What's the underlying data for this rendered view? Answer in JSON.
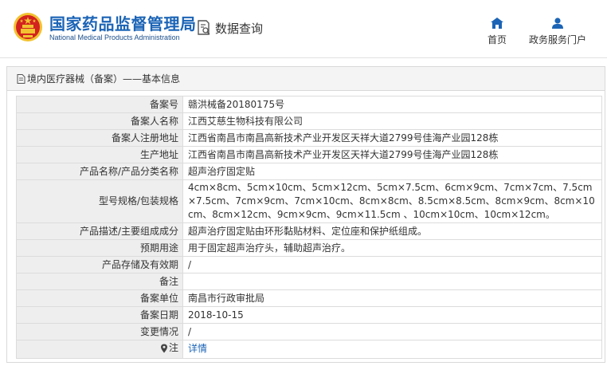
{
  "header": {
    "agency_cn": "国家药品监督管理局",
    "agency_en": "National Medical Products Administration",
    "query_label": "数据查询",
    "nav": [
      {
        "label": "首页",
        "icon": "home-icon"
      },
      {
        "label": "政务服务门户",
        "icon": "user-icon"
      }
    ]
  },
  "panel": {
    "title": "境内医疗器械（备案）——基本信息"
  },
  "rows": [
    {
      "label": "备案号",
      "value": "赣洪械备20180175号"
    },
    {
      "label": "备案人名称",
      "value": "江西艾慈生物科技有限公司"
    },
    {
      "label": "备案人注册地址",
      "value": "江西省南昌市南昌高新技术产业开发区天祥大道2799号佳海产业园128栋"
    },
    {
      "label": "生产地址",
      "value": "江西省南昌市南昌高新技术产业开发区天祥大道2799号佳海产业园128栋"
    },
    {
      "label": "产品名称/产品分类名称",
      "value": "超声治疗固定贴"
    },
    {
      "label": "型号规格/包装规格",
      "value": "4cm×8cm、5cm×10cm、5cm×12cm、5cm×7.5cm、6cm×9cm、7cm×7cm、7.5cm×7.5cm、7cm×9cm、7cm×10cm、8cm×8cm、8.5cm×8.5cm、8cm×9cm、8cm×10cm、8cm×12cm、9cm×9cm、9cm×11.5cm 、10cm×10cm、10cm×12cm。"
    },
    {
      "label": "产品描述/主要组成成分",
      "value": "超声治疗固定贴由环形黏贴材料、定位座和保护纸组成。"
    },
    {
      "label": "预期用途",
      "value": "用于固定超声治疗头，辅助超声治疗。"
    },
    {
      "label": "产品存储及有效期",
      "value": "/"
    },
    {
      "label": "备注",
      "value": ""
    },
    {
      "label": "备案单位",
      "value": "南昌市行政审批局"
    },
    {
      "label": "备案日期",
      "value": "2018-10-15"
    },
    {
      "label": "变更情况",
      "value": "/"
    },
    {
      "label": "注",
      "value": "详情"
    }
  ],
  "colors": {
    "brand_blue": "#1b64b6",
    "emblem_red": "#d2231f",
    "emblem_gold": "#f2c230"
  }
}
